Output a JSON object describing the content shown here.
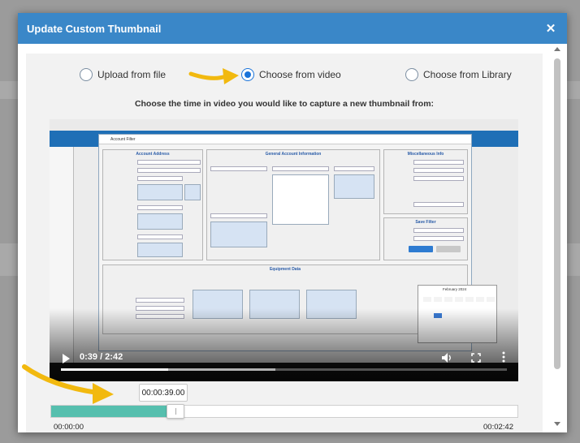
{
  "modal": {
    "title": "Update Custom Thumbnail",
    "close_label": "✕"
  },
  "source_options": [
    {
      "label": "Upload from file",
      "selected": false
    },
    {
      "label": "Choose from video",
      "selected": true
    },
    {
      "label": "Choose from Library",
      "selected": false
    }
  ],
  "instruction": "Choose the time in video you would like to capture a new thumbnail from:",
  "video": {
    "current_time": "0:39",
    "duration": "2:42",
    "time_display": "0:39 / 2:42",
    "progress_fraction": 0.24,
    "buffered_fraction": 0.48
  },
  "frame": {
    "dialog_title": "Account Filter",
    "groups": {
      "address": "Account Address",
      "general": "General Account Information",
      "misc": "Miscellaneous Info",
      "saved": "Save Filter",
      "equipment": "Equipment Data"
    },
    "calendar_month": "February 2024"
  },
  "timeline": {
    "selected_time": "00:00:39.00",
    "start_label": "00:00:00",
    "end_label": "00:02:42",
    "position_fraction": 0.24
  },
  "colors": {
    "header": "#3a87c8",
    "radio_selected": "#1a73d9",
    "slider_fill": "#56bfae",
    "annotation_arrow": "#f2b90f"
  }
}
